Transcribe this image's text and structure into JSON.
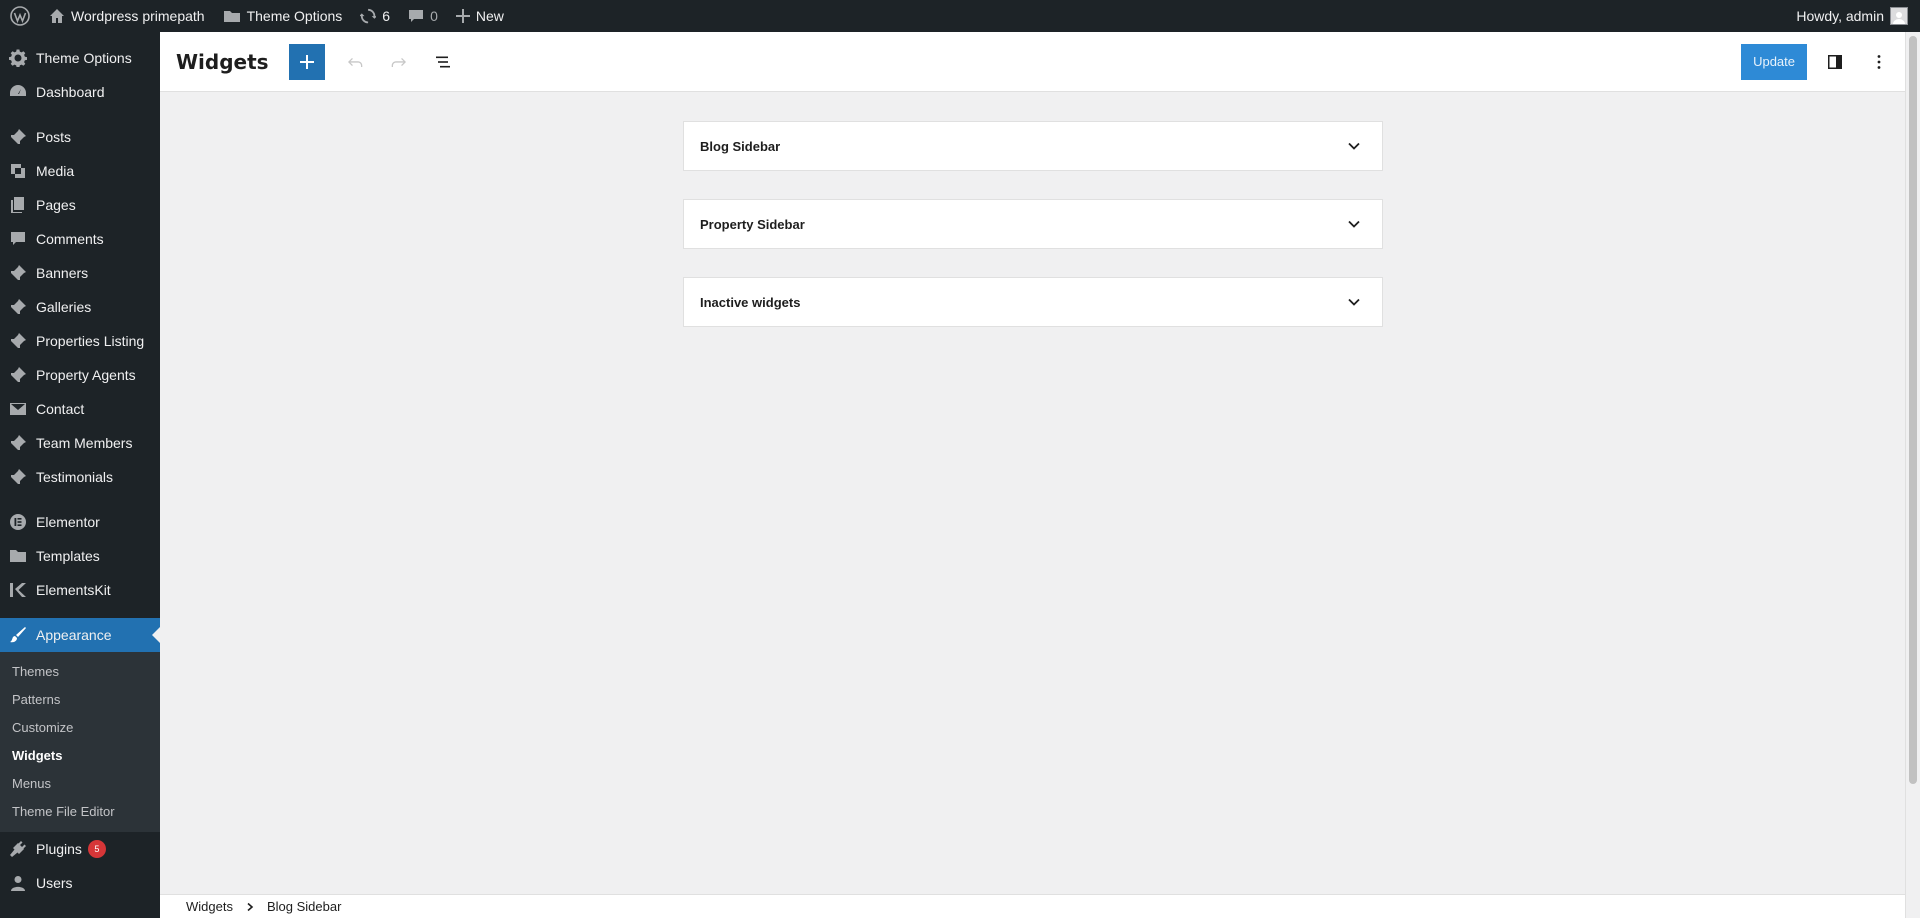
{
  "adminbar": {
    "site_name": "Wordpress primepath",
    "theme_options": "Theme Options",
    "updates_count": "6",
    "comments_count": "0",
    "new_label": "New",
    "howdy": "Howdy, admin"
  },
  "sidebar": {
    "items": [
      {
        "label": "Theme Options",
        "icon": "gear-icon"
      },
      {
        "label": "Dashboard",
        "icon": "dashboard-icon"
      },
      {
        "label": "Posts",
        "icon": "pin-icon"
      },
      {
        "label": "Media",
        "icon": "media-icon"
      },
      {
        "label": "Pages",
        "icon": "pages-icon"
      },
      {
        "label": "Comments",
        "icon": "comment-icon"
      },
      {
        "label": "Banners",
        "icon": "pin-icon"
      },
      {
        "label": "Galleries",
        "icon": "pin-icon"
      },
      {
        "label": "Properties Listing",
        "icon": "pin-icon"
      },
      {
        "label": "Property Agents",
        "icon": "pin-icon"
      },
      {
        "label": "Contact",
        "icon": "mail-icon"
      },
      {
        "label": "Team Members",
        "icon": "pin-icon"
      },
      {
        "label": "Testimonials",
        "icon": "pin-icon"
      },
      {
        "label": "Elementor",
        "icon": "elementor-icon"
      },
      {
        "label": "Templates",
        "icon": "folder-icon"
      },
      {
        "label": "ElementsKit",
        "icon": "elementskit-icon"
      },
      {
        "label": "Appearance",
        "icon": "brush-icon"
      },
      {
        "label": "Plugins",
        "icon": "plug-icon",
        "badge": "5"
      },
      {
        "label": "Users",
        "icon": "user-icon"
      }
    ],
    "submenu": [
      "Themes",
      "Patterns",
      "Customize",
      "Widgets",
      "Menus",
      "Theme File Editor"
    ]
  },
  "header": {
    "title": "Widgets",
    "update_label": "Update"
  },
  "panels": [
    "Blog Sidebar",
    "Property Sidebar",
    "Inactive widgets"
  ],
  "footer": {
    "crumb1": "Widgets",
    "crumb2": "Blog Sidebar"
  },
  "colors": {
    "admin_bg": "#1d2327",
    "accent": "#2271b1",
    "canvas_bg": "#f0f0f1"
  }
}
